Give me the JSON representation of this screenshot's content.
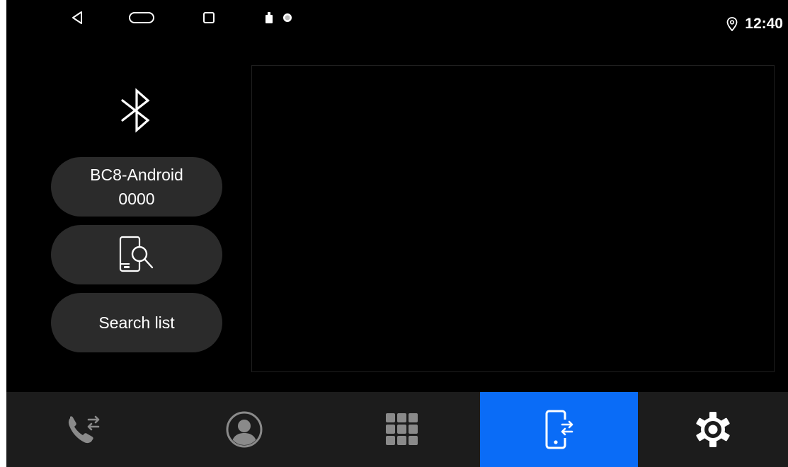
{
  "status_bar": {
    "time": "12:40",
    "nav_icons": [
      "back-icon",
      "home-icon",
      "recents-icon"
    ],
    "notification_icons": [
      "usb-icon",
      "record-icon"
    ],
    "location_icon": "location-pin-icon"
  },
  "bluetooth": {
    "logo_icon": "bluetooth-icon",
    "device_name": "BC8-Android",
    "pin_code": "0000",
    "search_icon": "phone-search-icon",
    "search_list_label": "Search list"
  },
  "device_list": {
    "items": []
  },
  "bottom_nav": {
    "items": [
      {
        "icon": "call-transfer-icon",
        "active": false
      },
      {
        "icon": "contacts-icon",
        "active": false
      },
      {
        "icon": "dialpad-icon",
        "active": false
      },
      {
        "icon": "device-transfer-icon",
        "active": true
      },
      {
        "icon": "settings-gear-icon",
        "active": false
      }
    ]
  },
  "colors": {
    "background": "#000000",
    "pill": "#2b2b2b",
    "nav_bar": "#1c1c1c",
    "accent": "#0a6cf7",
    "inactive_icon": "#8a8a8a",
    "foreground": "#ffffff"
  }
}
